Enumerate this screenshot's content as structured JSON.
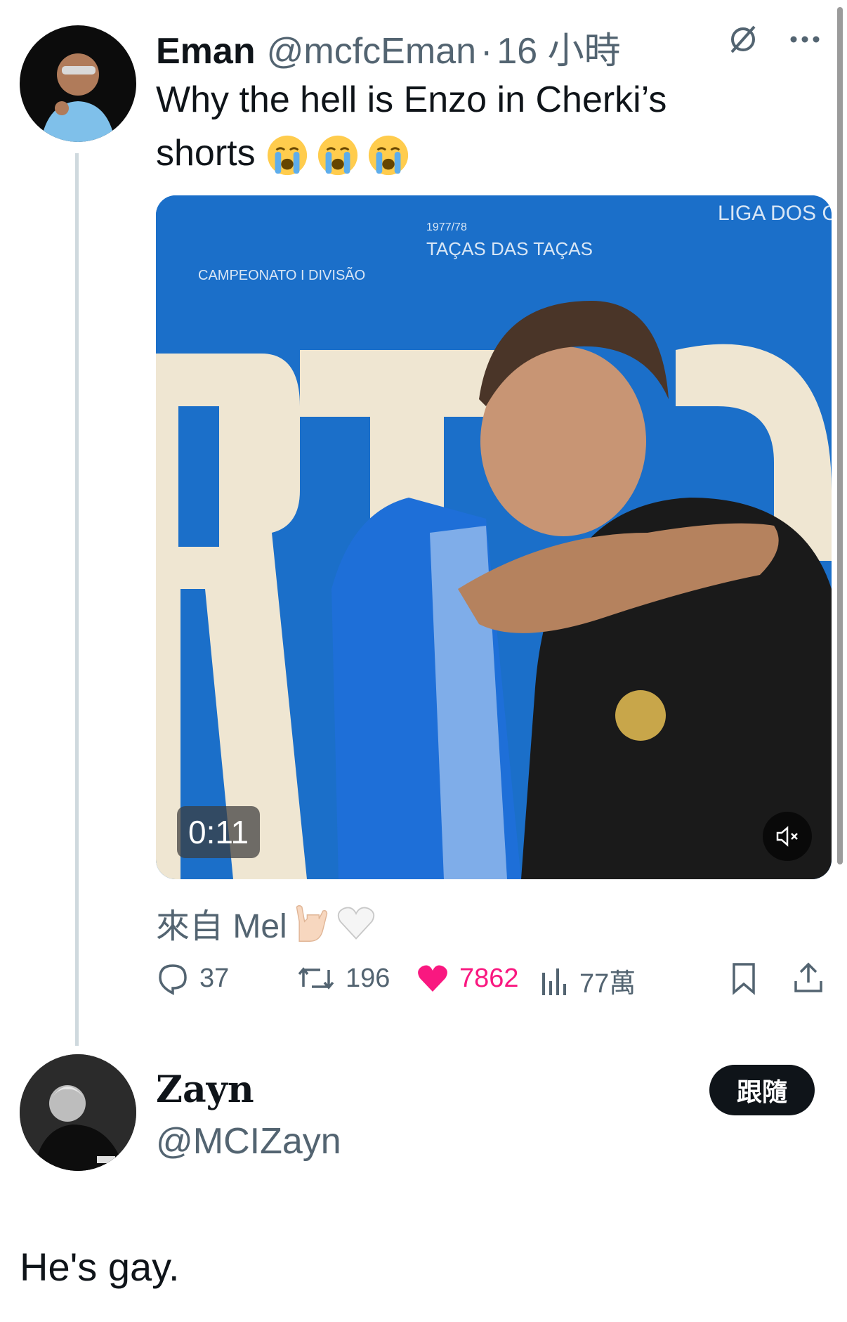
{
  "tweet": {
    "author_name": "Eman",
    "author_handle": "@mcfcEman",
    "separator": "·",
    "time": "16 小時",
    "text": "Why the hell is Enzo in Cherki’s shorts",
    "emoji": [
      "loudly-crying-face",
      "loudly-crying-face",
      "loudly-crying-face"
    ],
    "media": {
      "timestamp": "0:11",
      "wall_text": [
        "LIGA DOS CAMPEÕES",
        "TAÇAS DAS TAÇAS",
        "CAMPEONATO I DIVISÃO",
        "1977/78"
      ],
      "colors": {
        "wall_blue": "#1b6fc9",
        "letter_cream": "#efe6d2",
        "jersey_blue": "#1e6fd8",
        "jacket_black": "#1a1a1a"
      }
    },
    "source_label": "來自 Mel",
    "source_emoji": [
      "love-you-gesture",
      "white-heart"
    ],
    "stats": {
      "replies": "37",
      "reposts": "196",
      "likes": "7862",
      "views": "77萬"
    }
  },
  "reply": {
    "author_name": "Zayn",
    "author_handle": "@MCIZayn",
    "follow_label": "跟隨",
    "text": "He's gay."
  },
  "colors": {
    "like_pink": "#f91880",
    "text_secondary": "#536471",
    "thread_line": "#cfd9de"
  }
}
